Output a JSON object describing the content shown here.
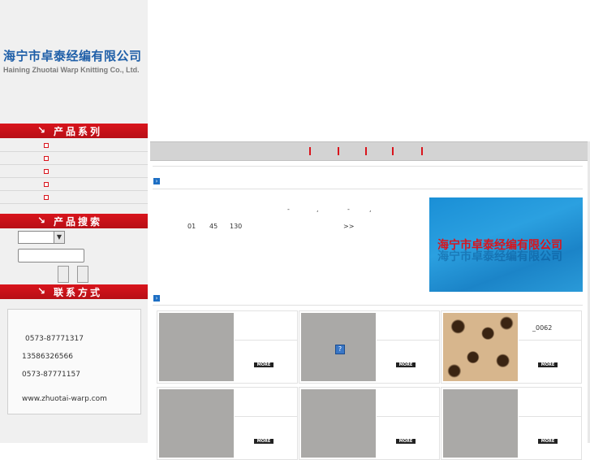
{
  "header": {
    "company_cn": "海宁市卓泰经编有限公司",
    "company_en": "Haining Zhuotai Warp Knitting Co., Ltd."
  },
  "sidebar": {
    "products_title": "产品系列",
    "search_title": "产品搜索",
    "contact_title": "联系方式",
    "product_items": [
      "",
      "",
      "",
      "",
      ""
    ],
    "contact": {
      "phone1": "0573-87771317",
      "mobile": "13586326566",
      "fax": "0573-87771157",
      "website": "www.zhuotai-warp.com"
    }
  },
  "intro": {
    "line1_marks": [
      "-",
      ",",
      "-",
      ","
    ],
    "line2_a": "01",
    "line2_b": "45",
    "line2_c": "130",
    "more_link": ">>"
  },
  "company_image_text": "海宁市卓泰经编有限公司",
  "products": [
    {
      "code": "",
      "more": "MORE"
    },
    {
      "code": "",
      "more": "MORE"
    },
    {
      "code": "_0062",
      "more": "MORE"
    },
    {
      "code": "",
      "more": "MORE"
    },
    {
      "code": "",
      "more": "MORE"
    },
    {
      "code": "",
      "more": "MORE"
    }
  ],
  "icons": {
    "section_arrow": "arrow-right-icon",
    "bar_arrow": "arrow-down-right-icon",
    "broken_image": "broken-image-icon"
  },
  "colors": {
    "brand_red": "#d9141c",
    "brand_blue": "#1f5fa8",
    "accent_blue": "#1e6fc4"
  }
}
